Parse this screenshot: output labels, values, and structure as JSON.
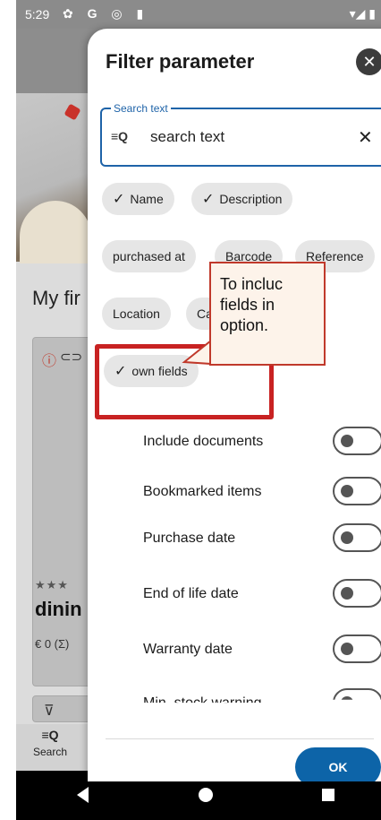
{
  "status_bar": {
    "time": "5:29",
    "icons": "✿ G ◎ ▮",
    "right": "▾◢ ▮"
  },
  "background": {
    "section_title": "My fir",
    "card": {
      "stars": "★★★",
      "title": "dinin",
      "price": "€ 0 (Σ)"
    },
    "bottom_nav": {
      "search_label": "Search"
    }
  },
  "filter": {
    "title": "Filter parameter",
    "search": {
      "label": "Search text",
      "value": "search text"
    },
    "chips": [
      {
        "label": "Name",
        "checked": true
      },
      {
        "label": "Description",
        "checked": true
      },
      {
        "label": "purchased at",
        "checked": false
      },
      {
        "label": "Barcode",
        "checked": false
      },
      {
        "label": "Reference",
        "checked": false
      },
      {
        "label": "Location",
        "checked": false
      },
      {
        "label": "Category",
        "checked": false
      },
      {
        "label": "own fields",
        "checked": true
      }
    ],
    "callout": [
      "To incluc",
      "fields in",
      "option."
    ],
    "options": [
      {
        "label": "Include documents",
        "on": false
      },
      {
        "label": "Bookmarked items",
        "on": false
      },
      {
        "label": "Purchase date",
        "on": false
      },
      {
        "label": "End of life date",
        "on": false
      },
      {
        "label": "Warranty date",
        "on": false
      },
      {
        "label": "Min. stock warning",
        "on": false
      }
    ],
    "ok_label": "OK"
  }
}
